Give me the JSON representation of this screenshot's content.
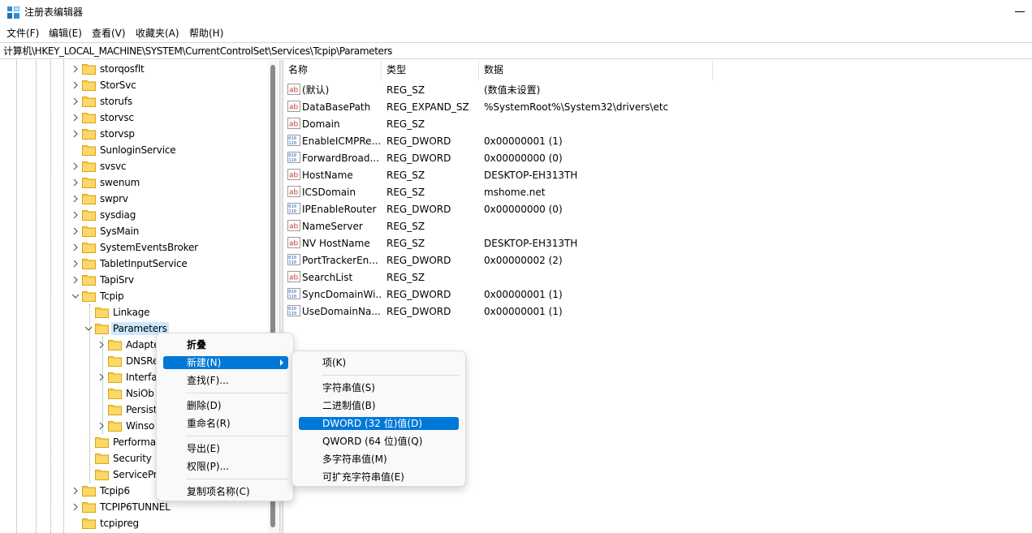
{
  "window": {
    "title": "注册表编辑器"
  },
  "menubar": {
    "items": [
      {
        "label": "文件(F)"
      },
      {
        "label": "编辑(E)"
      },
      {
        "label": "查看(V)"
      },
      {
        "label": "收藏夹(A)"
      },
      {
        "label": "帮助(H)"
      }
    ]
  },
  "address": {
    "path": "计算机\\HKEY_LOCAL_MACHINE\\SYSTEM\\CurrentControlSet\\Services\\Tcpip\\Parameters"
  },
  "tree": {
    "items": [
      {
        "label": "storqosflt"
      },
      {
        "label": "StorSvc"
      },
      {
        "label": "storufs"
      },
      {
        "label": "storvsc"
      },
      {
        "label": "storvsp"
      },
      {
        "label": "SunloginService"
      },
      {
        "label": "svsvc"
      },
      {
        "label": "swenum"
      },
      {
        "label": "swprv"
      },
      {
        "label": "sysdiag"
      },
      {
        "label": "SysMain"
      },
      {
        "label": "SystemEventsBroker"
      },
      {
        "label": "TabletInputService"
      },
      {
        "label": "TapiSrv"
      },
      {
        "label": "Tcpip"
      },
      {
        "label": "Linkage"
      },
      {
        "label": "Parameters"
      },
      {
        "label": "Adapte"
      },
      {
        "label": "DNSRe"
      },
      {
        "label": "Interfa"
      },
      {
        "label": "NsiOb"
      },
      {
        "label": "Persist"
      },
      {
        "label": "Winso"
      },
      {
        "label": "Performa"
      },
      {
        "label": "Security"
      },
      {
        "label": "ServicePr"
      },
      {
        "label": "Tcpip6"
      },
      {
        "label": "TCPIP6TUNNEL"
      },
      {
        "label": "tcpipreg"
      }
    ]
  },
  "list": {
    "columns": [
      "名称",
      "类型",
      "数据"
    ],
    "rows": [
      {
        "name": "(默认)",
        "type": "REG_SZ",
        "data": "(数值未设置)",
        "icon": "string-value-icon"
      },
      {
        "name": "DataBasePath",
        "type": "REG_EXPAND_SZ",
        "data": "%SystemRoot%\\System32\\drivers\\etc",
        "icon": "string-value-icon"
      },
      {
        "name": "Domain",
        "type": "REG_SZ",
        "data": "",
        "icon": "string-value-icon"
      },
      {
        "name": "EnableICMPRe...",
        "type": "REG_DWORD",
        "data": "0x00000001 (1)",
        "icon": "binary-value-icon"
      },
      {
        "name": "ForwardBroad...",
        "type": "REG_DWORD",
        "data": "0x00000000 (0)",
        "icon": "binary-value-icon"
      },
      {
        "name": "HostName",
        "type": "REG_SZ",
        "data": "DESKTOP-EH313TH",
        "icon": "string-value-icon"
      },
      {
        "name": "ICSDomain",
        "type": "REG_SZ",
        "data": "mshome.net",
        "icon": "string-value-icon"
      },
      {
        "name": "IPEnableRouter",
        "type": "REG_DWORD",
        "data": "0x00000000 (0)",
        "icon": "binary-value-icon"
      },
      {
        "name": "NameServer",
        "type": "REG_SZ",
        "data": "",
        "icon": "string-value-icon"
      },
      {
        "name": "NV HostName",
        "type": "REG_SZ",
        "data": "DESKTOP-EH313TH",
        "icon": "string-value-icon"
      },
      {
        "name": "PortTrackerEn...",
        "type": "REG_DWORD",
        "data": "0x00000002 (2)",
        "icon": "binary-value-icon"
      },
      {
        "name": "SearchList",
        "type": "REG_SZ",
        "data": "",
        "icon": "string-value-icon"
      },
      {
        "name": "SyncDomainWi...",
        "type": "REG_DWORD",
        "data": "0x00000001 (1)",
        "icon": "binary-value-icon"
      },
      {
        "name": "UseDomainNa...",
        "type": "REG_DWORD",
        "data": "0x00000001 (1)",
        "icon": "binary-value-icon"
      }
    ]
  },
  "context_menu": {
    "items": [
      {
        "label": "折叠"
      },
      {
        "label": "新建(N)"
      },
      {
        "label": "查找(F)..."
      },
      {
        "label": "删除(D)"
      },
      {
        "label": "重命名(R)"
      },
      {
        "label": "导出(E)"
      },
      {
        "label": "权限(P)..."
      },
      {
        "label": "复制项名称(C)"
      }
    ]
  },
  "submenu": {
    "items": [
      {
        "label": "项(K)"
      },
      {
        "label": "字符串值(S)"
      },
      {
        "label": "二进制值(B)"
      },
      {
        "label": "DWORD (32 位)值(D)"
      },
      {
        "label": "QWORD (64 位)值(Q)"
      },
      {
        "label": "多字符串值(M)"
      },
      {
        "label": "可扩充字符串值(E)"
      }
    ]
  },
  "colors": {
    "selection": "#cce8ff",
    "menu_highlight": "#0078d7",
    "folder": "#f7c94a"
  }
}
